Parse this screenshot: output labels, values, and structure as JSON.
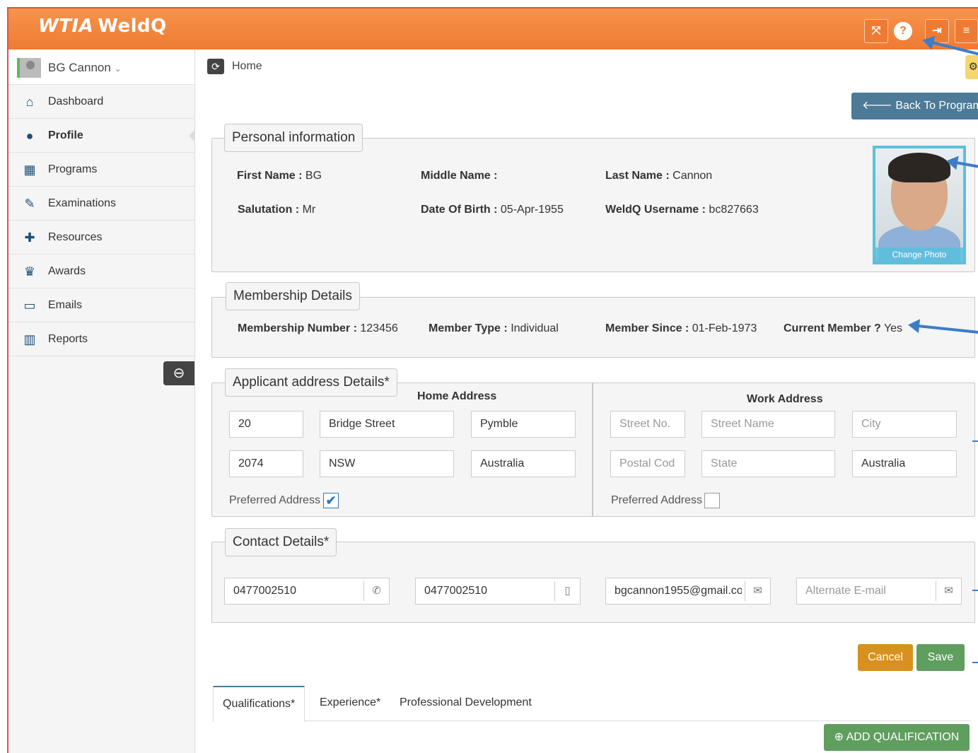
{
  "app": {
    "logo_wtia": "WTIA",
    "logo_name": "WeldQ"
  },
  "header": {
    "buttons": [
      {
        "icon": "fullscreen-icon",
        "glyph": "⤧"
      },
      {
        "icon": "help-icon",
        "glyph": "?"
      },
      {
        "icon": "logout-icon",
        "glyph": "⇥"
      },
      {
        "icon": "menu-icon",
        "glyph": "≡"
      }
    ]
  },
  "sidebar": {
    "user_name": "BG Cannon",
    "user_caret": "⌄",
    "items": [
      {
        "label": "Dashboard",
        "icon": "home-icon",
        "glyph": "⌂"
      },
      {
        "label": "Profile",
        "icon": "user-icon",
        "glyph": "●",
        "active": true
      },
      {
        "label": "Programs",
        "icon": "windows-icon",
        "glyph": "▦"
      },
      {
        "label": "Examinations",
        "icon": "edit-icon",
        "glyph": "✎"
      },
      {
        "label": "Resources",
        "icon": "puzzle-icon",
        "glyph": "✚"
      },
      {
        "label": "Awards",
        "icon": "trophy-icon",
        "glyph": "♛"
      },
      {
        "label": "Emails",
        "icon": "inbox-icon",
        "glyph": "▭"
      },
      {
        "label": "Reports",
        "icon": "bar-chart-icon",
        "glyph": "▥"
      }
    ],
    "collapse_glyph": "⊖"
  },
  "breadcrumb": {
    "icon_glyph": "⟳",
    "label": "Home"
  },
  "back_button": "🡐 Back To Programs",
  "personal": {
    "legend": "Personal information",
    "first_name_label": "First Name :",
    "first_name": "BG",
    "middle_name_label": "Middle Name :",
    "middle_name": "",
    "last_name_label": "Last Name :",
    "last_name": "Cannon",
    "salutation_label": "Salutation :",
    "salutation": "Mr",
    "dob_label": "Date Of Birth :",
    "dob": "05-Apr-1955",
    "username_label": "WeldQ Username :",
    "username": "bc827663",
    "change_photo": "Change Photo"
  },
  "membership": {
    "legend": "Membership Details",
    "number_label": "Membership Number :",
    "number": "123456",
    "type_label": "Member Type :",
    "type": "Individual",
    "since_label": "Member Since :",
    "since": "01-Feb-1973",
    "current_label": "Current Member ?",
    "current": "Yes"
  },
  "address": {
    "legend": "Applicant address Details*",
    "home": {
      "title": "Home Address",
      "street_no": "20",
      "street_name": "Bridge Street",
      "city": "Pymble",
      "postal": "2074",
      "state": "NSW",
      "country": "Australia",
      "preferred_label": "Preferred Address",
      "preferred": true
    },
    "work": {
      "title": "Work Address",
      "street_no_ph": "Street No.",
      "street_name_ph": "Street Name",
      "city_ph": "City",
      "postal_ph": "Postal Cod",
      "state_ph": "State",
      "country": "Australia",
      "preferred_label": "Preferred Address",
      "preferred": false
    }
  },
  "contact": {
    "legend": "Contact Details*",
    "phone": "0477002510",
    "mobile": "0477002510",
    "email": "bgcannon1955@gmail.co",
    "alt_email_ph": "Alternate E-mail"
  },
  "actions": {
    "cancel": "Cancel",
    "save": "Save"
  },
  "tabs": [
    {
      "label": "Qualifications*",
      "active": true
    },
    {
      "label": "Experience*"
    },
    {
      "label": "Professional Development"
    }
  ],
  "add_qualification": "⊕ ADD QUALIFICATION",
  "colors": {
    "header": "#ee7b33",
    "accent_blue": "#3d7dc8",
    "save_green": "#5f9e5f",
    "cancel_orange": "#d7911e",
    "back_btn": "#4c7a97"
  }
}
